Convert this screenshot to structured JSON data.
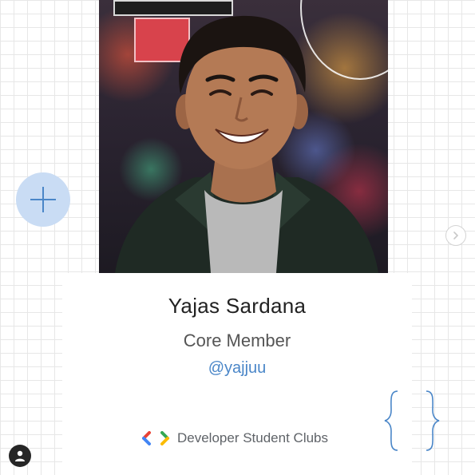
{
  "profile": {
    "name": "Yajas Sardana",
    "role": "Core Member",
    "handle": "@yajjuu"
  },
  "brand": {
    "name": "Developer Student Clubs"
  },
  "icons": {
    "plus": "plus-icon",
    "next": "chevron-right-icon",
    "braces": "curly-braces-icon",
    "profile": "user-icon",
    "logo": "dsc-logo-icon"
  },
  "colors": {
    "accent_blue": "#4a86c8",
    "plus_bg": "#c9dcf4",
    "logo_red": "#ea4335",
    "logo_blue": "#4285f4",
    "logo_green": "#34a853",
    "logo_yellow": "#fbbc05"
  }
}
